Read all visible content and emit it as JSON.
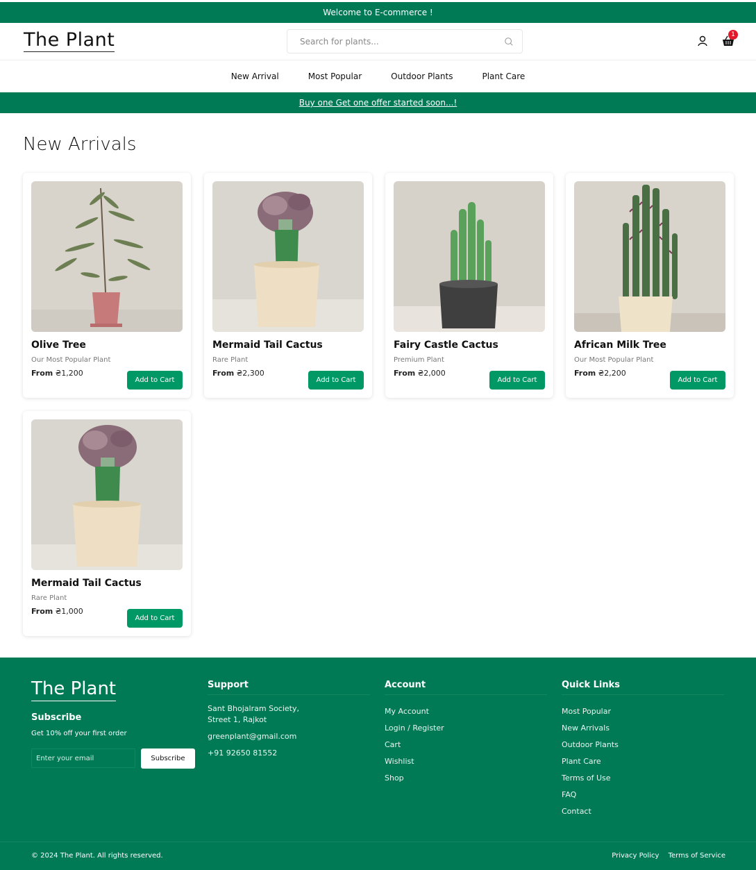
{
  "topbar": {
    "welcome": "Welcome to E-commerce !"
  },
  "header": {
    "logo": "The Plant",
    "search_placeholder": "Search for plants...",
    "cart_count": "1"
  },
  "nav": {
    "items": [
      "New Arrival",
      "Most Popular",
      "Outdoor Plants",
      "Plant Care"
    ]
  },
  "offer": {
    "text": "Buy one Get one offer started soon...!"
  },
  "section": {
    "title": "New Arrivals"
  },
  "products": [
    {
      "name": "Olive Tree",
      "tag": "Our Most Popular Plant",
      "from": "From",
      "price": "₴1,200",
      "button": "Add to Cart"
    },
    {
      "name": "Mermaid Tail Cactus",
      "tag": "Rare Plant",
      "from": "From",
      "price": "₴2,300",
      "button": "Add to Cart"
    },
    {
      "name": "Fairy Castle Cactus",
      "tag": "Premium Plant",
      "from": "From",
      "price": "₴2,000",
      "button": "Add to Cart"
    },
    {
      "name": "African Milk Tree",
      "tag": "Our Most Popular Plant",
      "from": "From",
      "price": "₴2,200",
      "button": "Add to Cart"
    },
    {
      "name": "Mermaid Tail Cactus",
      "tag": "Rare Plant",
      "from": "From",
      "price": "₴1,000",
      "button": "Add to Cart"
    }
  ],
  "footer": {
    "logo": "The Plant",
    "subscribe_title": "Subscribe",
    "subscribe_text": "Get 10% off your first order",
    "email_placeholder": "Enter your email",
    "subscribe_button": "Subscribe",
    "support": {
      "title": "Support",
      "address1": "Sant Bhojalram Society,",
      "address2": "Street 1, Rajkot",
      "email": "greenplant@gmail.com",
      "phone": "+91 92650 81552"
    },
    "account": {
      "title": "Account",
      "items": [
        "My Account",
        "Login / Register",
        "Cart",
        "Wishlist",
        "Shop"
      ]
    },
    "quick_links": {
      "title": "Quick Links",
      "items": [
        "Most Popular",
        "New Arrivals",
        "Outdoor Plants",
        "Plant Care",
        "Terms of Use",
        "FAQ",
        "Contact"
      ]
    },
    "copyright": "© 2024 The Plant. All rights reserved.",
    "privacy": "Privacy Policy",
    "terms": "Terms of Service"
  },
  "colors": {
    "brand": "#007a55",
    "button": "#009966",
    "badge": "#e4192c"
  }
}
